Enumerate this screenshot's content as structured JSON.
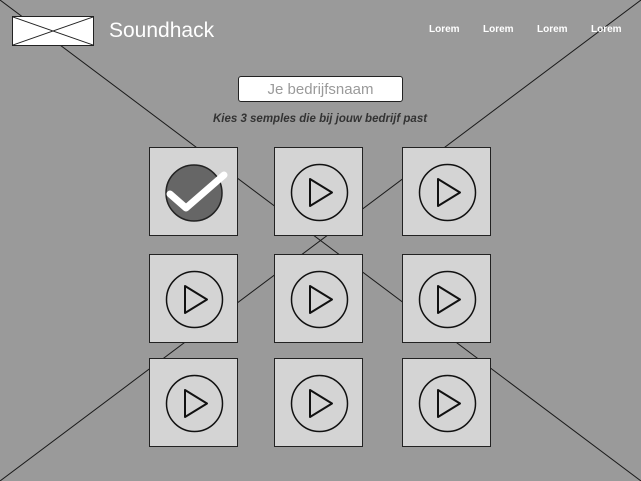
{
  "header": {
    "brand": "Soundhack",
    "nav": [
      {
        "label": "Lorem"
      },
      {
        "label": "Lorem"
      },
      {
        "label": "Lorem"
      },
      {
        "label": "Lorem"
      }
    ]
  },
  "form": {
    "company_placeholder": "Je bedrijfsnaam",
    "instruction": "Kies 3 semples die bij jouw bedrijf past"
  },
  "samples": [
    {
      "icon": "checkmark-icon",
      "selected": true
    },
    {
      "icon": "play-icon",
      "selected": false
    },
    {
      "icon": "play-icon",
      "selected": false
    },
    {
      "icon": "play-icon",
      "selected": false
    },
    {
      "icon": "play-icon",
      "selected": false
    },
    {
      "icon": "play-icon",
      "selected": false
    },
    {
      "icon": "play-icon",
      "selected": false
    },
    {
      "icon": "play-icon",
      "selected": false
    },
    {
      "icon": "play-icon",
      "selected": false
    }
  ],
  "colors": {
    "background": "#9a9a9a",
    "tile": "#d4d4d4",
    "selected_circle": "#666666",
    "text": "#ffffff"
  }
}
